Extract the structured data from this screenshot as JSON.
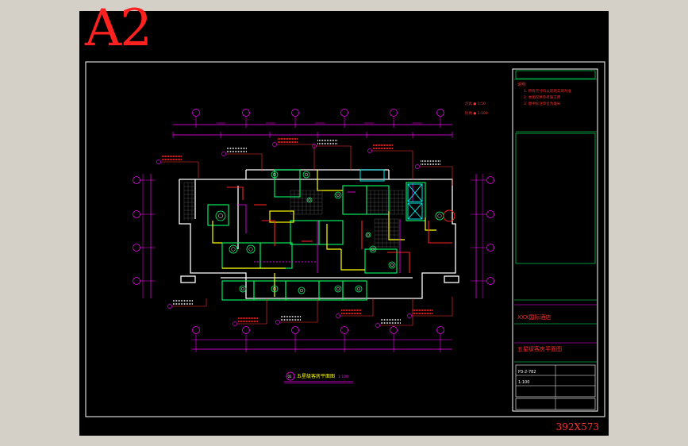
{
  "viewport": {
    "sheet_label": "A2",
    "size_label": "392X573"
  },
  "drawing": {
    "legend_lines": [
      "灯具 ●  1:50",
      "比例 ●  1:100"
    ],
    "drawing_title": "五星级客房平面图",
    "scale": "1:100",
    "callout_number": "01"
  },
  "title_block": {
    "notes_header": "说明:",
    "notes": [
      "1. 所有尺寸均以现场实测为准",
      "2. 本图仅供参考施工用",
      "3. 图中标注单位为毫米"
    ],
    "project_name": "XXX国际酒店",
    "drawing_name": "五星级客房平面图",
    "drawing_no": "P3-2-782",
    "scale_value": "1:100"
  },
  "colors": {
    "background": "#000000",
    "walls": "#ffffff",
    "dimensions": "#ff00ff",
    "annotations": "#ff3030",
    "fixtures": "#00ff66",
    "highlight": "#ffff00",
    "cyan": "#00ffff",
    "border": "#ffffff"
  }
}
